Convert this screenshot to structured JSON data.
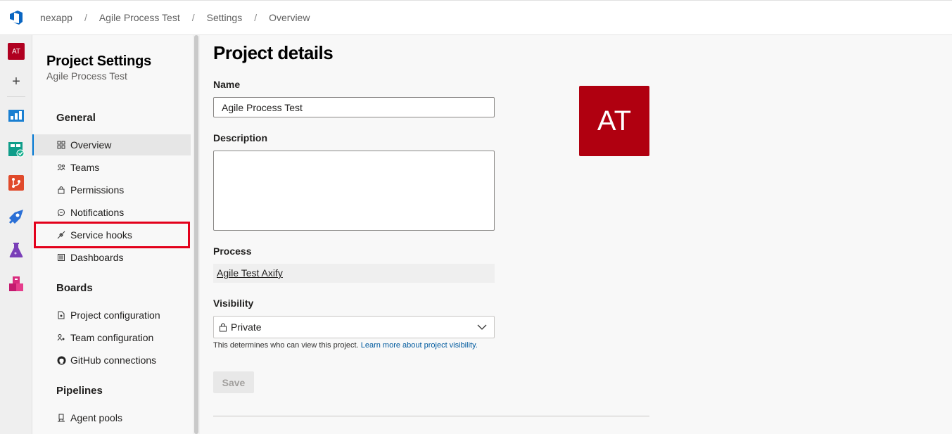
{
  "breadcrumb": [
    "nexapp",
    "Agile Process Test",
    "Settings",
    "Overview"
  ],
  "rail": {
    "avatar_initials": "AT"
  },
  "nav": {
    "title": "Project Settings",
    "subtitle": "Agile Process Test",
    "sections": [
      {
        "label": "General"
      },
      {
        "label": "Boards"
      },
      {
        "label": "Pipelines"
      }
    ],
    "items": [
      {
        "label": "Overview",
        "icon": "overview-icon"
      },
      {
        "label": "Teams",
        "icon": "teams-icon"
      },
      {
        "label": "Permissions",
        "icon": "lock-icon"
      },
      {
        "label": "Notifications",
        "icon": "chat-icon"
      },
      {
        "label": "Service hooks",
        "icon": "plug-icon"
      },
      {
        "label": "Dashboards",
        "icon": "dashboard-icon"
      },
      {
        "label": "Project configuration",
        "icon": "config-icon"
      },
      {
        "label": "Team configuration",
        "icon": "team-config-icon"
      },
      {
        "label": "GitHub connections",
        "icon": "github-icon"
      },
      {
        "label": "Agent pools",
        "icon": "agent-pool-icon"
      }
    ]
  },
  "main": {
    "title": "Project details",
    "name_label": "Name",
    "name_value": "Agile Process Test",
    "description_label": "Description",
    "description_value": "",
    "process_label": "Process",
    "process_value": "Agile Test Axify",
    "visibility_label": "Visibility",
    "visibility_value": "Private",
    "helper_text": "This determines who can view this project.",
    "helper_link": "Learn more about project visibility.",
    "save_label": "Save",
    "avatar_initials": "AT"
  },
  "colors": {
    "accent": "#0078d4",
    "avatar": "#b00010",
    "highlight": "#e3001b"
  }
}
